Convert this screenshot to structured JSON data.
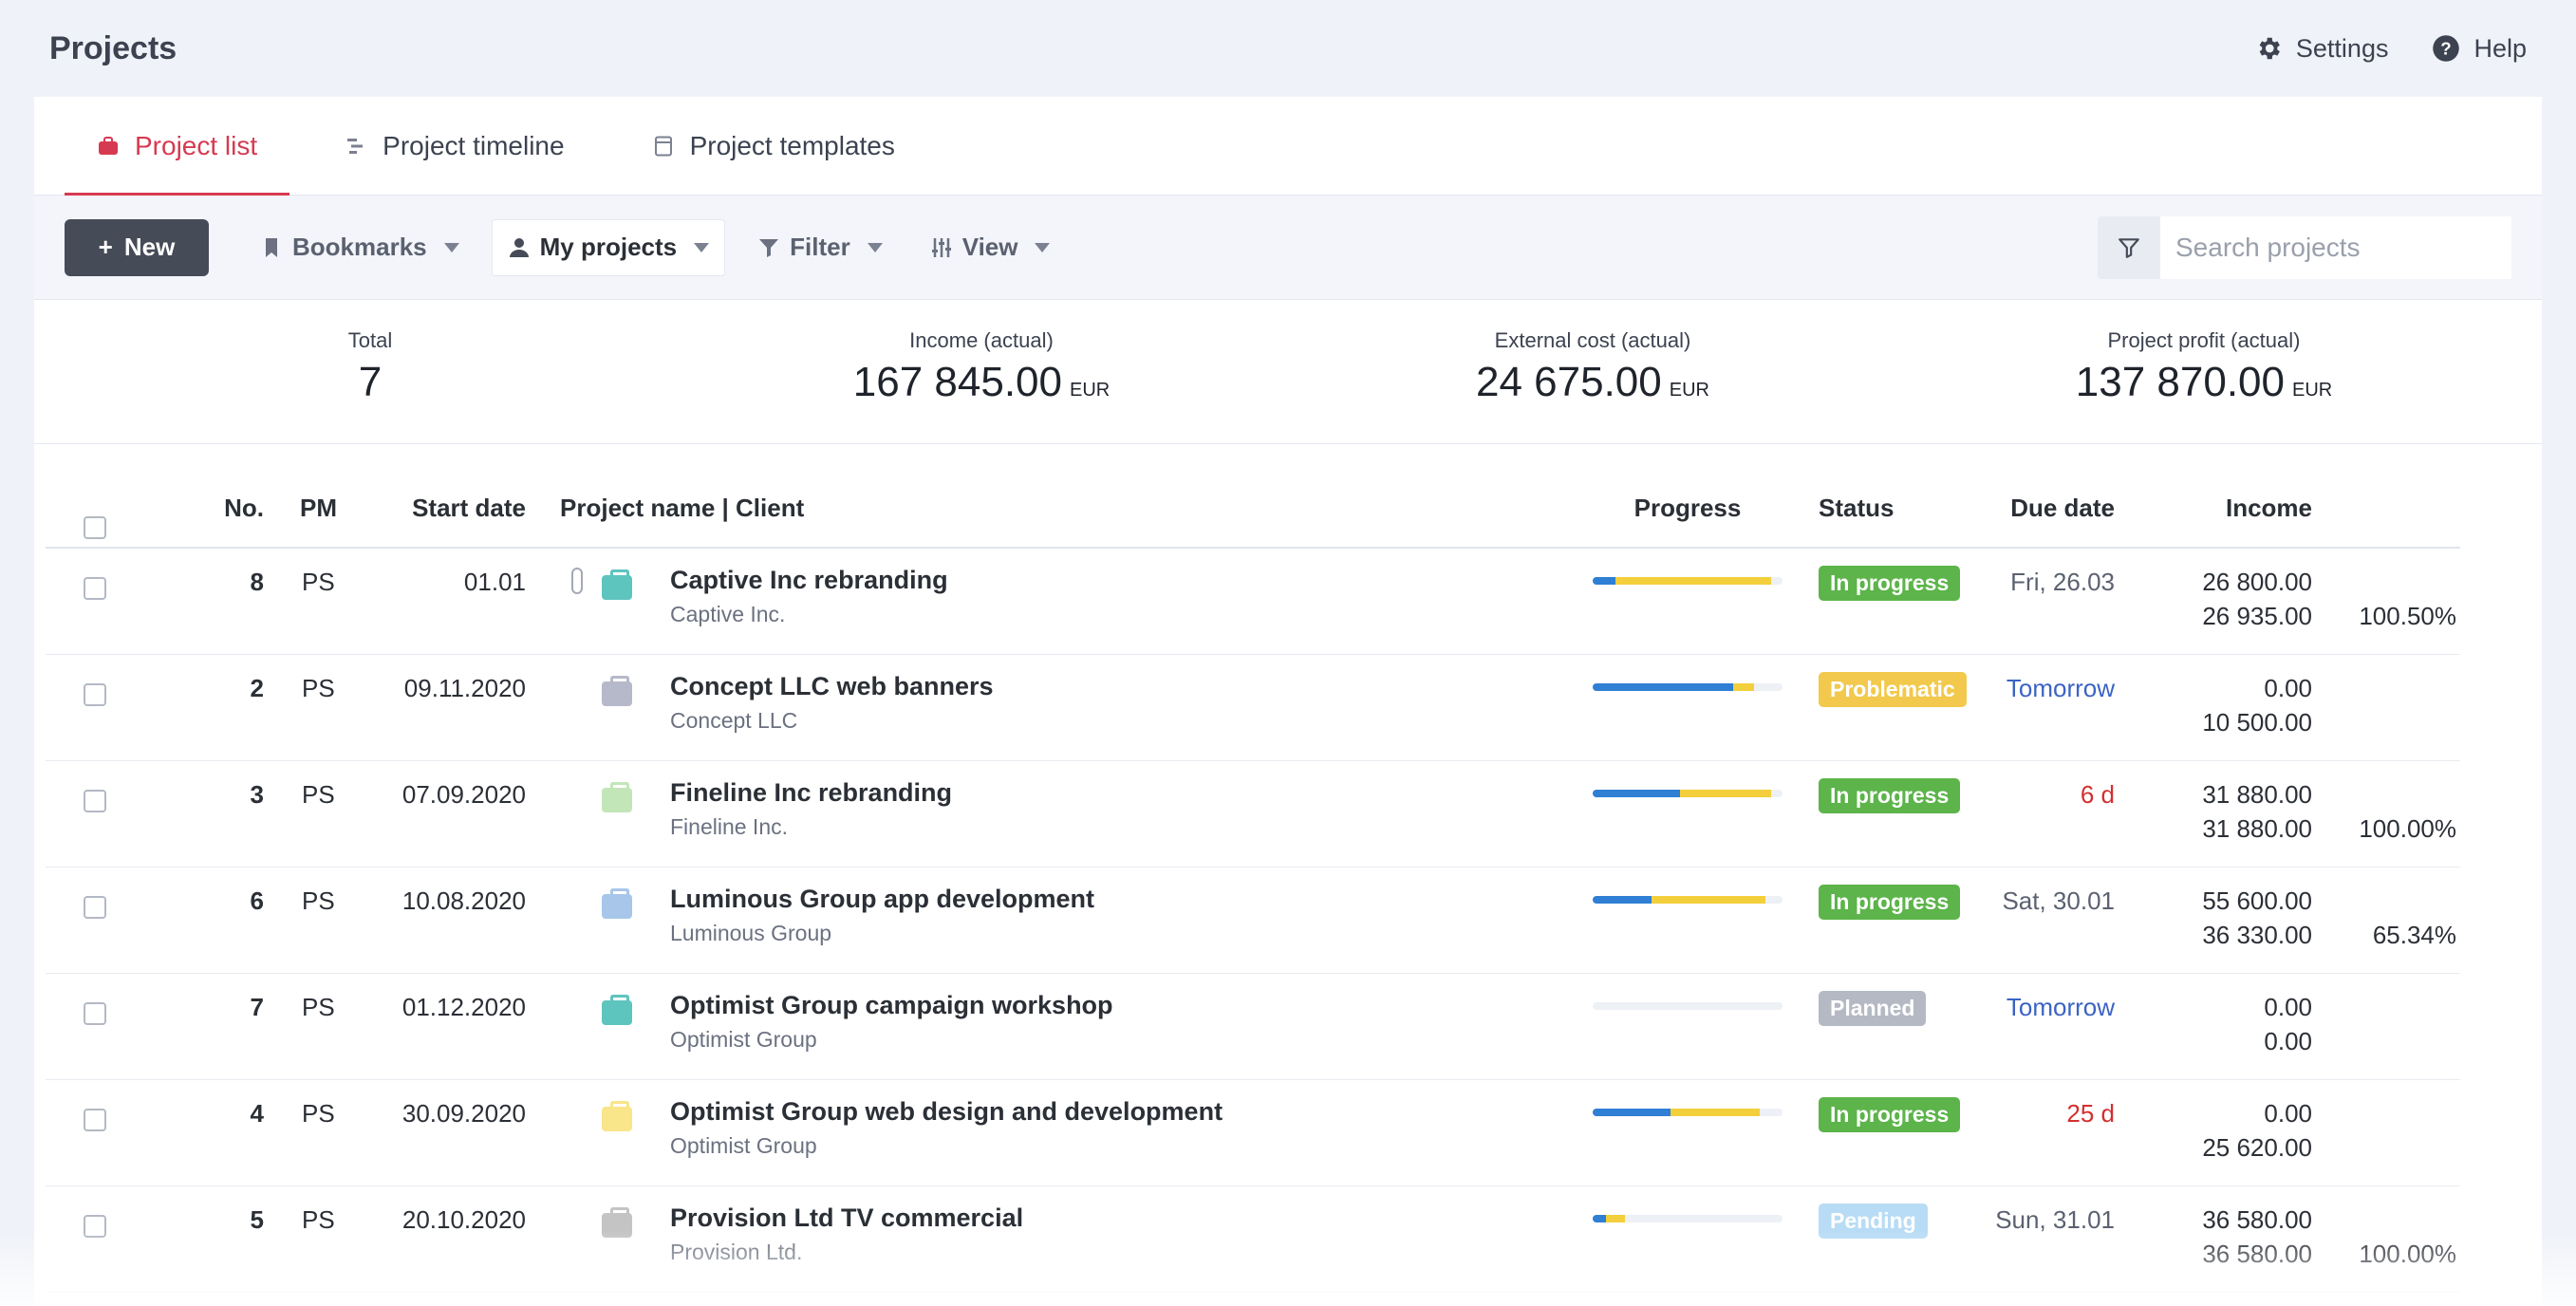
{
  "page": {
    "title": "Projects"
  },
  "top_actions": {
    "settings": "Settings",
    "help": "Help"
  },
  "tabs": [
    {
      "label": "Project list",
      "active": true,
      "icon": "briefcase-icon"
    },
    {
      "label": "Project timeline",
      "active": false,
      "icon": "timeline-icon"
    },
    {
      "label": "Project templates",
      "active": false,
      "icon": "template-icon"
    }
  ],
  "toolbar": {
    "new_label": "New",
    "bookmarks_label": "Bookmarks",
    "my_projects_label": "My projects",
    "filter_label": "Filter",
    "view_label": "View",
    "search_placeholder": "Search projects"
  },
  "summary": [
    {
      "label": "Total",
      "value": "7",
      "unit": ""
    },
    {
      "label": "Income (actual)",
      "value": "167 845.00",
      "unit": "EUR"
    },
    {
      "label": "External cost (actual)",
      "value": "24 675.00",
      "unit": "EUR"
    },
    {
      "label": "Project profit (actual)",
      "value": "137 870.00",
      "unit": "EUR"
    }
  ],
  "columns": {
    "no": "No.",
    "pm": "PM",
    "start": "Start date",
    "name": "Project name | Client",
    "progress": "Progress",
    "status": "Status",
    "due": "Due date",
    "income": "Income"
  },
  "colors": {
    "accent": "#d63a51",
    "in_progress": "#5cb44a",
    "problematic": "#f2c94c",
    "planned": "#b4b9c3",
    "pending": "#b8dcf5",
    "due_blue": "#3b63c4",
    "due_red": "#d32f2f"
  },
  "rows": [
    {
      "no": "8",
      "pm": "PS",
      "start": "01.01",
      "name": "Captive Inc rebranding",
      "client": "Captive Inc.",
      "folder_color": "#5ec4be",
      "attachment": true,
      "progress_blue": 0.12,
      "progress_yellow": 0.82,
      "status": "In progress",
      "status_color": "#5cb44a",
      "due": "Fri, 26.03",
      "due_color": "#5b6170",
      "income_1": "26 800.00",
      "income_2": "26 935.00",
      "percent": "100.50%"
    },
    {
      "no": "2",
      "pm": "PS",
      "start": "09.11.2020",
      "name": "Concept LLC web banners",
      "client": "Concept LLC",
      "folder_color": "#b5b9c9",
      "attachment": false,
      "progress_blue": 0.74,
      "progress_yellow": 0.11,
      "status": "Problematic",
      "status_color": "#f2c94c",
      "due": "Tomorrow",
      "due_color": "#3b63c4",
      "income_1": "0.00",
      "income_2": "10 500.00",
      "percent": ""
    },
    {
      "no": "3",
      "pm": "PS",
      "start": "07.09.2020",
      "name": "Fineline Inc rebranding",
      "client": "Fineline Inc.",
      "folder_color": "#c2e6b8",
      "attachment": false,
      "progress_blue": 0.46,
      "progress_yellow": 0.48,
      "status": "In progress",
      "status_color": "#5cb44a",
      "due": "6 d",
      "due_color": "#d32f2f",
      "income_1": "31 880.00",
      "income_2": "31 880.00",
      "percent": "100.00%"
    },
    {
      "no": "6",
      "pm": "PS",
      "start": "10.08.2020",
      "name": "Luminous Group app development",
      "client": "Luminous Group",
      "folder_color": "#a7c6ea",
      "attachment": false,
      "progress_blue": 0.31,
      "progress_yellow": 0.6,
      "status": "In progress",
      "status_color": "#5cb44a",
      "due": "Sat, 30.01",
      "due_color": "#5b6170",
      "income_1": "55 600.00",
      "income_2": "36 330.00",
      "percent": "65.34%"
    },
    {
      "no": "7",
      "pm": "PS",
      "start": "01.12.2020",
      "name": "Optimist Group campaign workshop",
      "client": "Optimist Group",
      "folder_color": "#5ec4be",
      "attachment": false,
      "progress_blue": 0,
      "progress_yellow": 0,
      "status": "Planned",
      "status_color": "#b4b9c3",
      "due": "Tomorrow",
      "due_color": "#3b63c4",
      "income_1": "0.00",
      "income_2": "0.00",
      "percent": ""
    },
    {
      "no": "4",
      "pm": "PS",
      "start": "30.09.2020",
      "name": "Optimist Group web design and development",
      "client": "Optimist Group",
      "folder_color": "#f9e58a",
      "attachment": false,
      "progress_blue": 0.41,
      "progress_yellow": 0.47,
      "status": "In progress",
      "status_color": "#5cb44a",
      "due": "25 d",
      "due_color": "#d32f2f",
      "income_1": "0.00",
      "income_2": "25 620.00",
      "percent": ""
    },
    {
      "no": "5",
      "pm": "PS",
      "start": "20.10.2020",
      "name": "Provision Ltd TV commercial",
      "client": "Provision Ltd.",
      "folder_color": "#c4c4c4",
      "attachment": false,
      "progress_blue": 0.07,
      "progress_yellow": 0.1,
      "status": "Pending",
      "status_color": "#b8dcf5",
      "due": "Sun, 31.01",
      "due_color": "#5b6170",
      "income_1": "36 580.00",
      "income_2": "36 580.00",
      "percent": "100.00%"
    }
  ]
}
